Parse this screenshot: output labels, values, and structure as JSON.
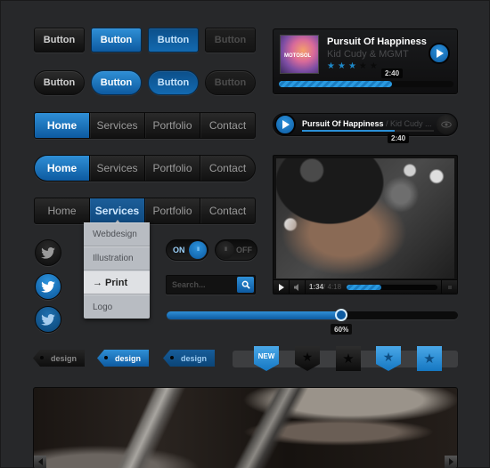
{
  "buttons": {
    "row1": [
      "Button",
      "Button",
      "Button",
      "Button"
    ],
    "row2": [
      "Button",
      "Button",
      "Button",
      "Button"
    ]
  },
  "nav": {
    "bar1": [
      "Home",
      "Services",
      "Portfolio",
      "Contact"
    ],
    "bar2": [
      "Home",
      "Services",
      "Portfolio",
      "Contact"
    ],
    "bar3": [
      "Home",
      "Services",
      "Portfolio",
      "Contact"
    ]
  },
  "dropdown": {
    "items": [
      "Webdesign",
      "Illustration",
      "→ Print",
      "Logo"
    ],
    "selected": "→ Print"
  },
  "social": {
    "icon": "twitter-bird-icon"
  },
  "toggles": {
    "on_label": "ON",
    "off_label": "OFF",
    "knob_grip": "III"
  },
  "search": {
    "placeholder": "Search...",
    "icon": "search-icon"
  },
  "slider": {
    "value_percent": 60,
    "label": "60%"
  },
  "tags": [
    "design",
    "design",
    "design"
  ],
  "ribbons": {
    "new_label": "NEW",
    "star": "★"
  },
  "player_card": {
    "title": "Pursuit Of Happiness",
    "artist": "Kid Cudy & MGMT",
    "rating": 3,
    "rating_max": 5,
    "time": "2:40",
    "progress_percent": 65,
    "album_art_text": "MOTOSOL"
  },
  "player_compact": {
    "title": "Pursuit Of Happiness",
    "artist": " / Kid Cudy ...",
    "time": "2:40",
    "progress_percent": 70
  },
  "video_player": {
    "current_time": "1:34",
    "total_time": "/ 4:18",
    "progress_percent": 38
  },
  "colors": {
    "accent_blue": "#1a7cc0",
    "background": "#27282a",
    "star_on": "#1e88c8"
  }
}
